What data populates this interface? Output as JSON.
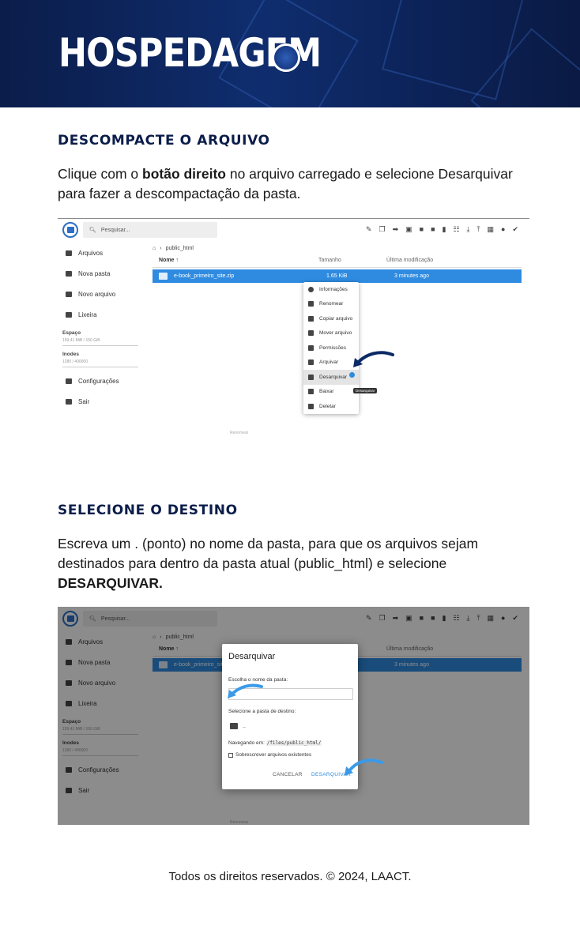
{
  "banner": {
    "title": "HOSPEDAGEM"
  },
  "step1": {
    "heading": "DESCOMPACTE O ARQUIVO",
    "text_before": "Clique com o ",
    "text_bold": "botão direito",
    "text_after": " no arquivo carregado e selecione Desarquivar para fazer a descompactação da pasta."
  },
  "step2": {
    "heading": "SELECIONE O DESTINO",
    "text": "Escreva um . (ponto) no nome da pasta, para que os arquivos sejam destinados para dentro da pasta atual (public_html) e selecione ",
    "text_bold": "DESARQUIVAR."
  },
  "filemanager": {
    "search_placeholder": "Pesquisar...",
    "sidebar": [
      "Arquivos",
      "Nova pasta",
      "Novo arquivo",
      "Lixeira"
    ],
    "space_label": "Espaço",
    "space_value": "159.41 MiB / 150 GiB",
    "inodes_label": "Inodes",
    "inodes_value": "1280 / 400000",
    "settings": "Configurações",
    "logout": "Sair",
    "breadcrumb": "public_html",
    "col_name": "Nome ↑",
    "col_size": "Tamanho",
    "col_modified": "Última modificação",
    "file_name": "e-book_primeiro_site.zip",
    "file_size": "1.65 KiB",
    "file_modified": "3 minutes ago",
    "bottom_label": "Renomear"
  },
  "context_menu": [
    "Informações",
    "Renomear",
    "Copiar arquivo",
    "Mover arquivo",
    "Permissões",
    "Arquivar",
    "Desarquivar",
    "Baixar",
    "Deletar"
  ],
  "tooltip": "Desarquivar",
  "dialog": {
    "title": "Desarquivar",
    "name_label": "Escolha o nome da pasta:",
    "name_value": ".",
    "dest_label": "Selecione a pasta de destino:",
    "folder_item": "..",
    "browse_prefix": "Navegando em:",
    "browse_path": "/files/public_html/",
    "overwrite_label": "Sobrescrever arquivos existentes",
    "cancel": "CANCELAR",
    "confirm": "DESARQUIVAR"
  },
  "footer": "Todos os direitos reservados. © 2024, LAACT.",
  "colors": {
    "navy": "#0b1d4a",
    "accent_blue": "#2f8be0",
    "arrow_blue": "#3a9ae8"
  }
}
